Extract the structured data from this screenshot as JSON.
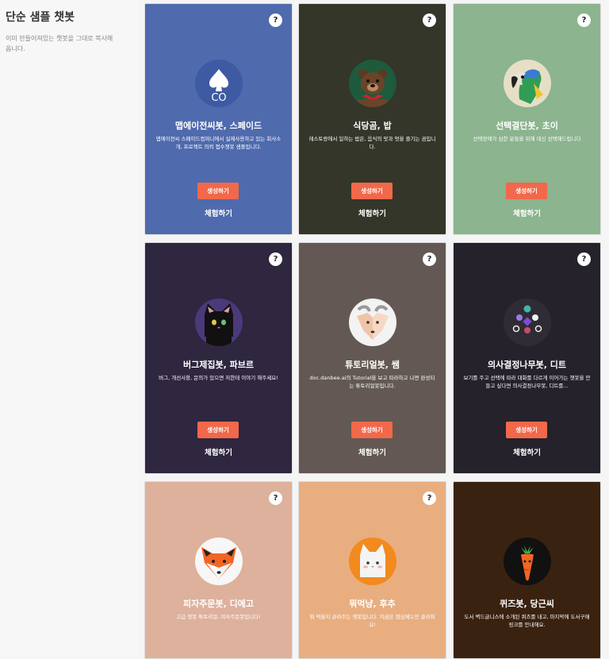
{
  "sidebar": {
    "title": "단순 샘플 챗봇",
    "desc": "이미 만들어져있는 챗봇을 그대로 복사해옵니다."
  },
  "common": {
    "help": "?",
    "generate": "생성하기",
    "try": "체험하기"
  },
  "cards": [
    {
      "title": "맵에이전씨봇, 스페이드",
      "desc": "맵에이전씨 스페이드컴퍼니에서 실제사용하고 있는 회사소개, 프로젝트 의뢰 접수챗봇 샘플입니다.",
      "bg": "#4f6aad",
      "avatar": "spade-co-icon"
    },
    {
      "title": "식당곰, 밥",
      "desc": "레스토랑에서 일하는 밥은, 음식의 맛과 멋을 즐기는 곰입니다.",
      "bg": "#333629",
      "avatar": "bear-icon"
    },
    {
      "title": "선택결단봇, 초이",
      "desc": "선택장애가 심한 분들을 위해 대신 선택해드립니다",
      "bg": "#8bb48f",
      "avatar": "parrot-icon"
    },
    {
      "title": "버그제집봇, 파브르",
      "desc": "버그, 개선사항, 문의가 있으면 저한테 이야기 해주세요!",
      "bg": "#2f2640",
      "avatar": "black-cat-icon"
    },
    {
      "title": "튜토리얼봇, 쌤",
      "desc": "doc.danbee.ai의 Tutorial을 보고 따라하고 나면 완성되는 튜토리얼봇입니다.",
      "bg": "#635853",
      "avatar": "goat-icon"
    },
    {
      "title": "의사결정나무봇, 디트",
      "desc": "보기를 주고 선택에 따라 대화를 다르게 이어가는 챗봇을 만들고 싶다면 의사결정나무봇, 디트를...",
      "bg": "#25222b",
      "avatar": "decision-tree-icon"
    },
    {
      "title": "피자주문봇, 디에고",
      "desc": "고급 챗봇 튜토리얼, 피자주문봇입니다!",
      "bg": "#ddb19c",
      "avatar": "fox-icon"
    },
    {
      "title": "뭐먹냥, 후추",
      "desc": "뭐 먹을지 골라주는 챗봇입니다. 지금은 점심메뉴만 골라줘요!",
      "bg": "#e8ae80",
      "avatar": "white-cat-icon"
    },
    {
      "title": "퀴즈봇, 당근씨",
      "desc": "도서 벽드글니스에 소개된 퀴즈를 내고, 마지막에 도서구매 링크를 안내해요.",
      "bg": "#3a2210",
      "avatar": "carrot-icon"
    }
  ]
}
